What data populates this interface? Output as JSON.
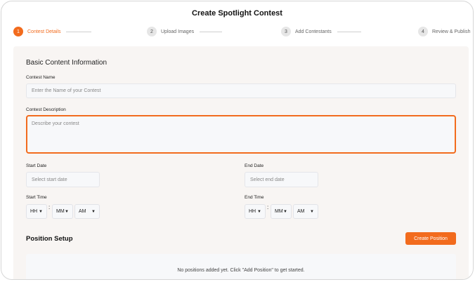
{
  "page": {
    "title": "Create Spotlight Contest"
  },
  "stepper": {
    "steps": [
      {
        "number": "1",
        "label": "Contest Details",
        "state": "active"
      },
      {
        "number": "2",
        "label": "Upload Images",
        "state": "pending"
      },
      {
        "number": "3",
        "label": "Add Contestants",
        "state": "pending"
      },
      {
        "number": "4",
        "label": "Review & Publish",
        "state": "pending"
      }
    ]
  },
  "form": {
    "section_title": "Basic Content Information",
    "contest_name": {
      "label": "Contest Name",
      "placeholder": "Enter the Name of your Contest",
      "value": ""
    },
    "contest_description": {
      "label": "Contest Description",
      "placeholder": "Describe your contest",
      "value": ""
    },
    "start_date": {
      "label": "Start Date",
      "placeholder": "Select start date"
    },
    "end_date": {
      "label": "End Date",
      "placeholder": "Select end date"
    },
    "start_time": {
      "label": "Start Time",
      "hour": "HH",
      "minute": "MM",
      "period": "AM",
      "separator": ":"
    },
    "end_time": {
      "label": "End Time",
      "hour": "HH",
      "minute": "MM",
      "period": "AM",
      "separator": ":"
    }
  },
  "position_setup": {
    "title": "Position Setup",
    "create_button": "Create Position",
    "empty_message": "No positions added yet. Click \"Add Position\" to get started."
  },
  "colors": {
    "accent": "#f26b1d",
    "panel_bg": "#f8f5f3",
    "input_bg": "#f7f8fa"
  },
  "icons": {
    "select_chevron": "chevron-down-icon"
  }
}
